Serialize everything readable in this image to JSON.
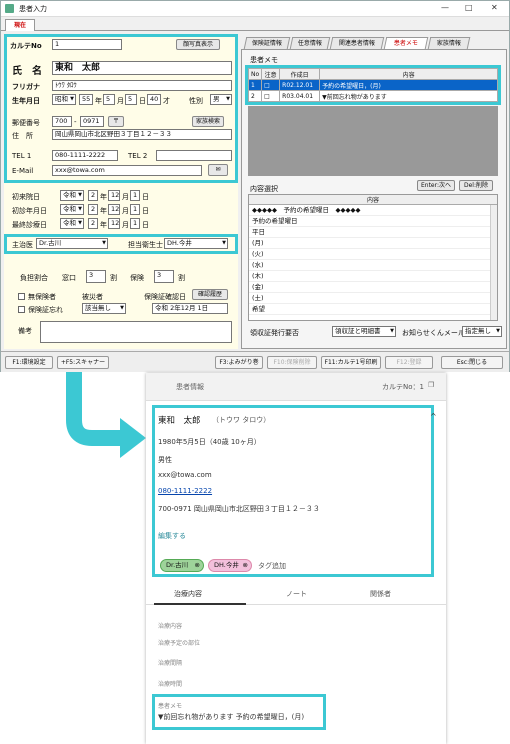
{
  "window": {
    "title": "患者入力",
    "controls": [
      "—",
      "□",
      "✕"
    ],
    "tab_current": "現在"
  },
  "left": {
    "karte_label": "カルテNo",
    "karte_value": "1",
    "photo_btn": "顔写真表示",
    "name_label": "氏　名",
    "name_value": "東和　太郎",
    "furigana_label": "フリガナ",
    "furigana_value": "ﾄｳﾜ ﾀﾛｳ",
    "birth_label": "生年月日",
    "era": "昭和",
    "year": "55",
    "year_u": "年",
    "month": "5",
    "month_u": "月",
    "day": "5",
    "day_u": "日",
    "age": "40",
    "age_u": "才",
    "sex_label": "性別",
    "sex": "男",
    "zip_label": "郵便番号",
    "zip1": "700",
    "zip2": "0971",
    "zip_btn": "〒",
    "addr_btn": "家族検索",
    "addr_label": "住　所",
    "addr_value": "岡山県岡山市北区野田３丁目１２－３３",
    "tel1_label": "TEL 1",
    "tel1": "080-1111-2222",
    "tel2_label": "TEL 2",
    "tel2": "",
    "mail_label": "E-Mail",
    "mail": "xxx@towa.com",
    "mail_icon": "envelope-icon",
    "first_label": "初来院日",
    "first_era": "令和",
    "first_y": "2",
    "first_m": "12",
    "first_d": "1",
    "check_label": "初診年月日",
    "check_era": "令和",
    "check_y": "2",
    "check_m": "12",
    "check_d": "1",
    "last_label": "最終診療日",
    "last_era": "令和",
    "last_y": "2",
    "last_m": "12",
    "last_d": "1",
    "y_u": "年",
    "m_u": "月",
    "d_u": "日",
    "doctor_label": "主治医",
    "doctor": "Dr.古川",
    "hyg_label": "担当衛生士",
    "hyg": "DH.今井",
    "burden_label": "負担割合",
    "window_label": "窓口",
    "window_val": "3",
    "wari": "割",
    "insure_label": "保険",
    "insure_val": "3",
    "uninsured": "無保険者",
    "insured_label": "被災者",
    "cert_label": "保険証確認日",
    "confirm_btn": "確認履歴",
    "forgot": "保険証忘れ",
    "forgot_sel": "該当無し",
    "cert_date": "令和 2年12月 1日",
    "memo_label": "備考"
  },
  "right": {
    "tabs": [
      "保険証情報",
      "任意情報",
      "関連患者情報",
      "患者メモ",
      "家族情報"
    ],
    "memo_title": "患者メモ",
    "grid_headers": [
      "No",
      "注意",
      "作成日",
      "内容"
    ],
    "grid_rows": [
      {
        "no": "1",
        "date": "R02.12.01",
        "content": "予約の希望曜日，(月)"
      },
      {
        "no": "2",
        "date": "R03.04.01",
        "content": "▼前回忘れ物があります"
      }
    ],
    "select_title": "内容選択",
    "enter_btn": "Enter:次へ",
    "del_btn": "Del:削除",
    "list_header": "内容",
    "list": [
      "◆◆◆◆◆　予約の希望曜日　◆◆◆◆◆",
      "予約の希望曜日",
      "平日",
      "(月)",
      "(火)",
      "(水)",
      "(木)",
      "(金)",
      "(土)",
      "希望"
    ],
    "receipt_label": "領収証発行要否",
    "receipt_val": "領収証と明細書",
    "notice_label": "お知らせくんメール",
    "notice_val": "指定無し"
  },
  "fkeys": [
    "F1:環境設定",
    "+F5:スキャナー",
    "F3:よみがり巻",
    "F10:保険削除",
    "F11:カルテ1号印刷",
    "F12:登録",
    "Esc:閉じる"
  ],
  "mobile": {
    "header": "患者情報",
    "karte": "カルテNo：1",
    "copy_icon": "copy-icon",
    "name": "東和　太郎",
    "kana": "（トウワ タロウ）",
    "birth": "1980年5月5日（40歳 10ヶ月）",
    "sex": "男性",
    "mail": "xxx@towa.com",
    "tel": "080-1111-2222",
    "addr": "700-0971 岡山県岡山市北区野田３丁目１２－３３",
    "edit": "編集する",
    "chips": [
      "Dr.古川",
      "DH.今井"
    ],
    "tag_add": "タグ追加",
    "tabs": [
      "治療内容",
      "ノート",
      "関係者"
    ],
    "fields": [
      "治療内容",
      "治療予定の部位",
      "治療間隔",
      "治療時間"
    ],
    "memo_label": "患者メモ",
    "memo_text": "▼前回忘れ物があります 予約の希望曜日，(月)"
  },
  "colors": {
    "highlight": "#3cc8d3",
    "panel": "#fffde8",
    "select": "#0a64c8",
    "chip_green": "#9ed39a",
    "chip_pink": "#f3c0dc"
  }
}
